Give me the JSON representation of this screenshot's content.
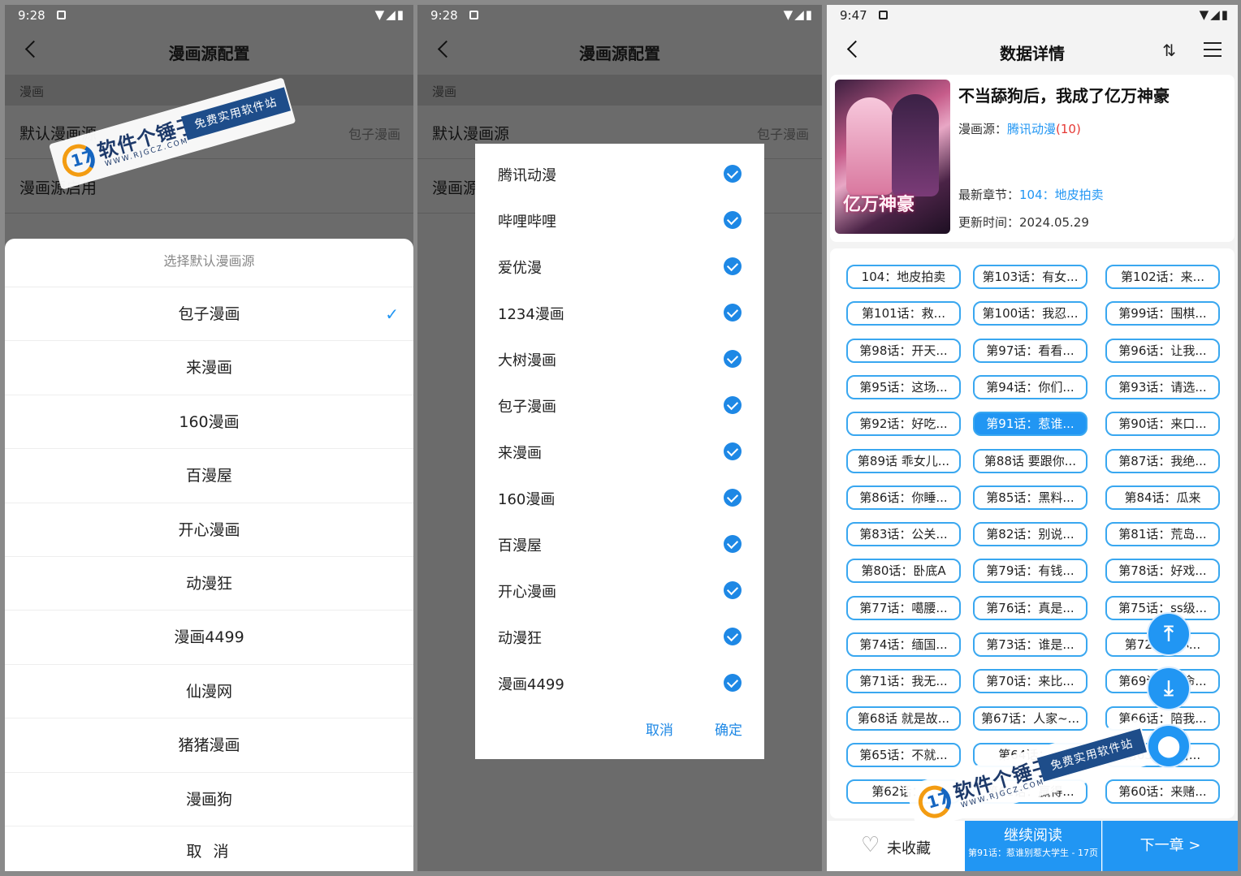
{
  "panel1": {
    "time": "9:28",
    "title": "漫画源配置",
    "section": "漫画",
    "default_source_label": "默认漫画源",
    "default_source_value": "包子漫画",
    "enable_label": "漫画源启用",
    "sheet_title": "选择默认漫画源",
    "options": [
      "包子漫画",
      "来漫画",
      "160漫画",
      "百漫屋",
      "开心漫画",
      "动漫狂",
      "漫画4499",
      "仙漫网",
      "猪猪漫画",
      "漫画狗"
    ],
    "selected_index": 0,
    "cancel": "取 消"
  },
  "panel2": {
    "time": "9:28",
    "title": "漫画源配置",
    "section": "漫画",
    "default_source_label": "默认漫画源",
    "default_source_value": "包子漫画",
    "enable_label": "漫画源",
    "dialog_items": [
      "腾讯动漫",
      "哔哩哔哩",
      "爱优漫",
      "1234漫画",
      "大树漫画",
      "包子漫画",
      "来漫画",
      "160漫画",
      "百漫屋",
      "开心漫画",
      "动漫狂",
      "漫画4499"
    ],
    "cancel": "取消",
    "confirm": "确定"
  },
  "panel3": {
    "time": "9:47",
    "title": "数据详情",
    "book_title": "不当舔狗后，我成了亿万神豪",
    "cover_text": "亿万神豪",
    "source_label": "漫画源：",
    "source_value": "腾讯动漫",
    "source_count": "(10)",
    "latest_label": "最新章节：",
    "latest_value": "104：地皮拍卖",
    "updated": "更新时间：2024.05.29",
    "chapters": [
      "104：地皮拍卖",
      "第103话：有女...",
      "第102话：来...",
      "第101话：救...",
      "第100话：我忍...",
      "第99话：围棋...",
      "第98话：开天...",
      "第97话：看看...",
      "第96话：让我...",
      "第95话：这场...",
      "第94话：你们...",
      "第93话：请选...",
      "第92话：好吃...",
      "第91话：惹谁...",
      "第90话：来口...",
      "第89话 乖女儿...",
      "第88话 要跟你...",
      "第87话：我绝...",
      "第86话：你睡...",
      "第85话：黑料...",
      "第84话：瓜来",
      "第83话：公关...",
      "第82话：别说...",
      "第81话：荒岛...",
      "第80话：卧底A",
      "第79话：有钱...",
      "第78话：好戏...",
      "第77话：噶腰...",
      "第76话：真是...",
      "第75话：ss级...",
      "第74话：缅国...",
      "第73话：谁是...",
      "第72话：小...",
      "第71话：我无...",
      "第70话：来比...",
      "第69话：拿命...",
      "第68话 就是故...",
      "第67话：人家~...",
      "第66话：陪我...",
      "第65话：不就...",
      "第64话：...",
      "第63话：富...",
      "第62话：...",
      "第61话：赢得...",
      "第60话：来赌..."
    ],
    "selected_chapter": 13,
    "fav_label": "未收藏",
    "continue_title": "继续阅读",
    "continue_sub": "第91话：惹谁别惹大学生 - 17页",
    "next_label": "下一章 >"
  },
  "watermark": {
    "name": "软件个锤子",
    "site": "WWW.RJGCZ.COM",
    "tag": "免费实用软件站",
    "logo_glyph": "17"
  },
  "colors": {
    "accent": "#2196f3",
    "overlay": "#6b6b6b"
  }
}
